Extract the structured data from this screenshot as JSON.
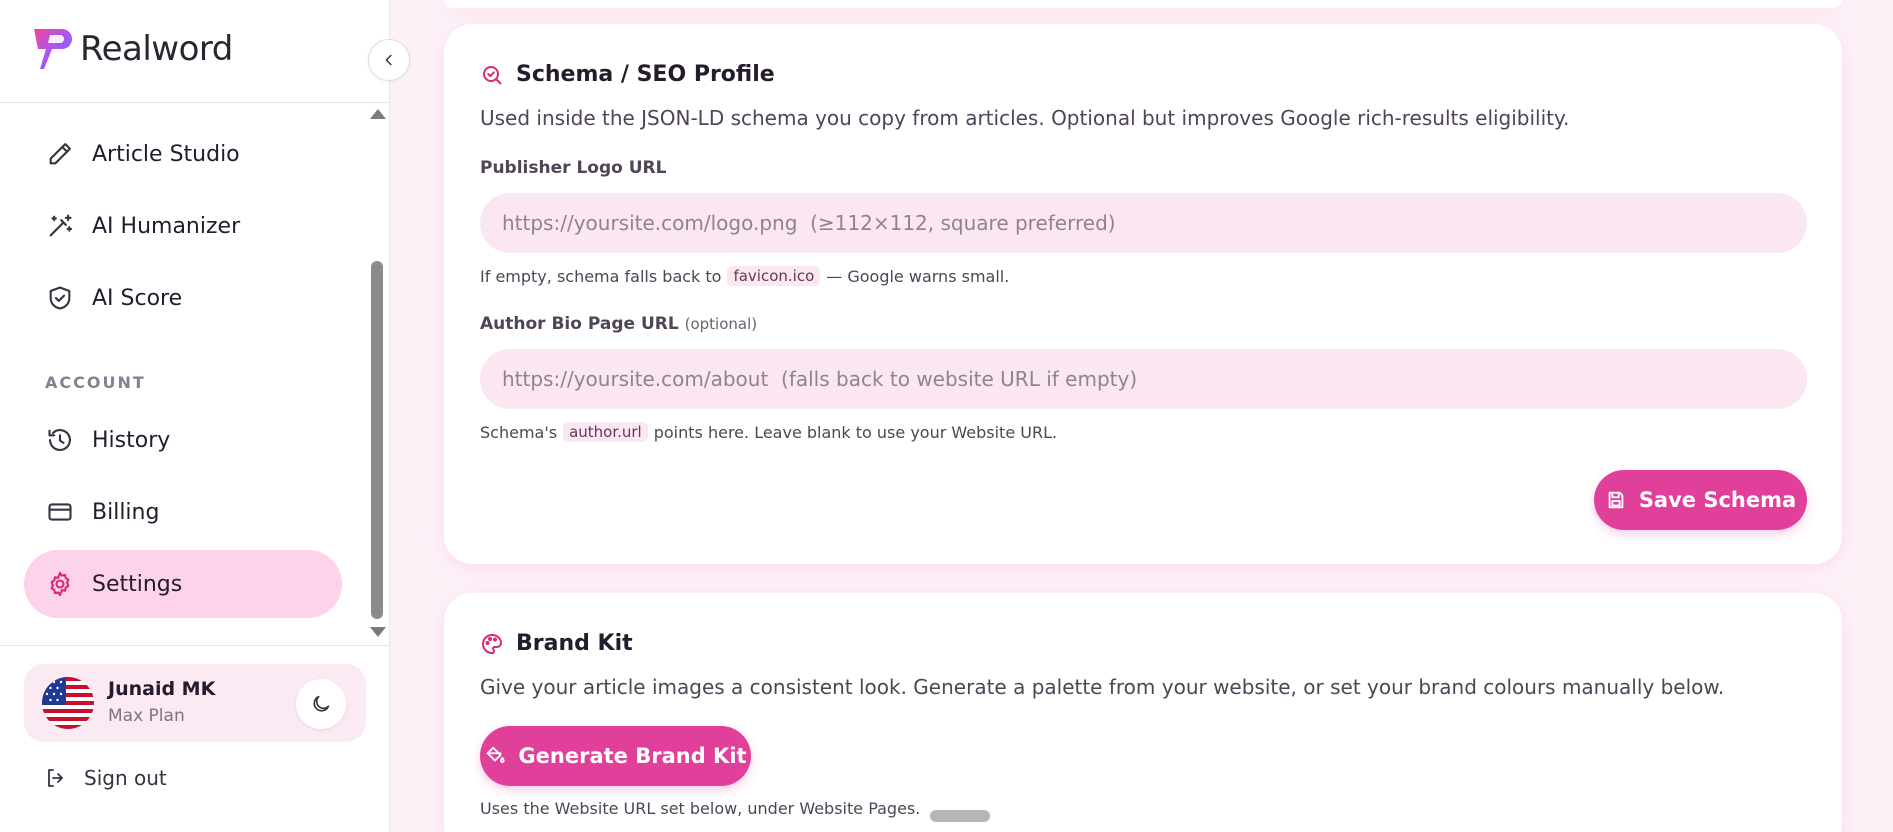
{
  "app": {
    "name": "Realword"
  },
  "sidebar": {
    "items": [
      {
        "label": "Article Studio",
        "icon": "pencil-icon"
      },
      {
        "label": "AI Humanizer",
        "icon": "magic-wand-icon"
      },
      {
        "label": "AI Score",
        "icon": "shield-check-icon"
      }
    ],
    "account_label": "ACCOUNT",
    "account_items": [
      {
        "label": "History",
        "icon": "history-icon"
      },
      {
        "label": "Billing",
        "icon": "credit-card-icon"
      },
      {
        "label": "Settings",
        "icon": "gear-icon",
        "active": true
      }
    ],
    "user": {
      "name": "Junaid MK",
      "plan": "Max Plan"
    },
    "sign_out": "Sign out"
  },
  "schema_card": {
    "title": "Schema / SEO Profile",
    "description": "Used inside the JSON-LD schema you copy from articles. Optional but improves Google rich-results eligibility.",
    "logo_label": "Publisher Logo URL",
    "logo_value": "",
    "logo_placeholder": "https://yoursite.com/logo.png  (≥112×112, square preferred)",
    "logo_helper_before": "If empty, schema falls back to",
    "logo_helper_code": "favicon.ico",
    "logo_helper_after": "— Google warns small.",
    "bio_label": "Author Bio Page URL",
    "bio_optional": "(optional)",
    "bio_value": "",
    "bio_placeholder": "https://yoursite.com/about  (falls back to website URL if empty)",
    "bio_helper_before": "Schema's",
    "bio_helper_code": "author.url",
    "bio_helper_after": "points here. Leave blank to use your Website URL.",
    "save_label": "Save Schema"
  },
  "brand_card": {
    "title": "Brand Kit",
    "description": "Give your article images a consistent look. Generate a palette from your website, or set your brand colours manually below.",
    "generate_label": "Generate Brand Kit",
    "helper": "Uses the Website URL set below, under Website Pages."
  },
  "colors": {
    "accent": "#e0409a",
    "active_bg": "#fcd3ea",
    "input_bg": "#fbe7f2",
    "page_bg": "#fdf1f8"
  }
}
